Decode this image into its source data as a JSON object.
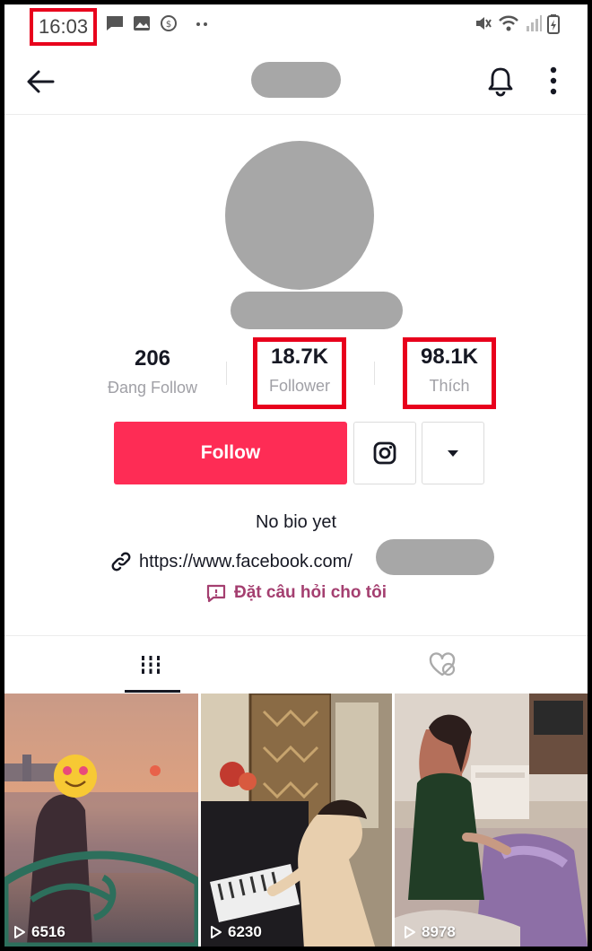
{
  "status_bar": {
    "time": "16:03"
  },
  "header": {
    "back_icon": "arrow-left-icon",
    "bell_icon": "bell-icon",
    "more_icon": "more-vertical-icon"
  },
  "profile": {
    "stats": [
      {
        "value": "206",
        "label": "Đang Follow"
      },
      {
        "value": "18.7K",
        "label": "Follower"
      },
      {
        "value": "98.1K",
        "label": "Thích"
      }
    ],
    "follow_label": "Follow",
    "instagram_icon": "instagram-icon",
    "dropdown_icon": "caret-down-icon",
    "bio": "No bio yet",
    "link": "https://www.facebook.com/",
    "qa_label": "Đặt câu hỏi cho tôi"
  },
  "colors": {
    "accent": "#fe2c55",
    "highlight_box": "#e8001c",
    "qa_text": "#a43f70"
  },
  "videos": [
    {
      "views": "6516"
    },
    {
      "views": "6230"
    },
    {
      "views": "8978"
    }
  ]
}
